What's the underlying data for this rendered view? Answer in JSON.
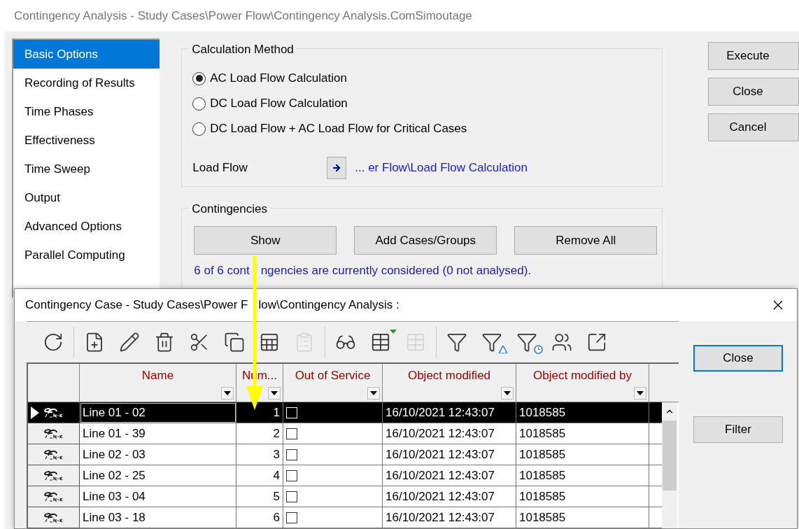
{
  "window": {
    "title": "Contingency Analysis - Study Cases\\Power Flow\\Contingency Analysis.ComSimoutage"
  },
  "sidebar": {
    "items": [
      {
        "label": "Basic Options",
        "selected": true
      },
      {
        "label": "Recording of Results",
        "selected": false
      },
      {
        "label": "Time Phases",
        "selected": false
      },
      {
        "label": "Effectiveness",
        "selected": false
      },
      {
        "label": "Time Sweep",
        "selected": false
      },
      {
        "label": "Output",
        "selected": false
      },
      {
        "label": "Advanced Options",
        "selected": false
      },
      {
        "label": "Parallel Computing",
        "selected": false
      }
    ]
  },
  "calculation_method": {
    "label": "Calculation Method",
    "options": [
      {
        "label": "AC Load Flow Calculation",
        "selected": true
      },
      {
        "label": "DC Load Flow Calculation",
        "selected": false
      },
      {
        "label": "DC Load Flow + AC Load Flow for Critical Cases",
        "selected": false
      }
    ],
    "load_flow": {
      "label": "Load Flow",
      "link": "... er Flow\\Load Flow Calculation"
    }
  },
  "contingencies": {
    "label": "Contingencies",
    "buttons": [
      "Show",
      "Add Cases/Groups",
      "Remove All"
    ],
    "status": [
      "6 of 6 cont",
      "ngencies are currently considered (0 not analysed)."
    ]
  },
  "buttons": [
    "Execute",
    "Close",
    "Cancel"
  ],
  "dialog": {
    "title": [
      "Contingency Case - Study Cases\\Power F",
      "low\\Contingency Analysis :"
    ],
    "toolbar": [
      [
        {
          "kind": "refresh",
          "disabled": false
        }
      ],
      [
        {
          "kind": "new",
          "disabled": false
        },
        {
          "kind": "edit",
          "disabled": false
        },
        {
          "kind": "delete",
          "disabled": false
        },
        {
          "kind": "cut",
          "disabled": false
        },
        {
          "kind": "copy",
          "disabled": false
        },
        {
          "kind": "copy-table",
          "disabled": false
        },
        {
          "kind": "paste",
          "disabled": true
        }
      ],
      [
        {
          "kind": "view",
          "disabled": false
        },
        {
          "kind": "table-select",
          "disabled": false
        },
        {
          "kind": "table",
          "disabled": true
        }
      ],
      [
        {
          "kind": "filter",
          "disabled": false
        },
        {
          "kind": "filter-warning",
          "disabled": false
        },
        {
          "kind": "filter-time",
          "disabled": false
        },
        {
          "kind": "users",
          "disabled": false
        },
        {
          "kind": "export",
          "disabled": false
        }
      ]
    ],
    "columns": [
      "Name",
      "Num...",
      "Out of Service",
      "Object modified",
      "Object modified by"
    ],
    "rows": [
      {
        "selected": true,
        "name": "Line 01 - 02",
        "number": "1",
        "out_of_service": false,
        "modified": "16/10/2021 12:43:07",
        "modified_by": "1018585"
      },
      {
        "selected": false,
        "name": "Line 01 - 39",
        "number": "2",
        "out_of_service": false,
        "modified": "16/10/2021 12:43:07",
        "modified_by": "1018585"
      },
      {
        "selected": false,
        "name": "Line 02 - 03",
        "number": "3",
        "out_of_service": false,
        "modified": "16/10/2021 12:43:07",
        "modified_by": "1018585"
      },
      {
        "selected": false,
        "name": "Line 02 - 25",
        "number": "4",
        "out_of_service": false,
        "modified": "16/10/2021 12:43:07",
        "modified_by": "1018585"
      },
      {
        "selected": false,
        "name": "Line 03 - 04",
        "number": "5",
        "out_of_service": false,
        "modified": "16/10/2021 12:43:07",
        "modified_by": "1018585"
      },
      {
        "selected": false,
        "name": "Line 03 - 18",
        "number": "6",
        "out_of_service": false,
        "modified": "16/10/2021 12:43:07",
        "modified_by": "1018585"
      }
    ],
    "buttons": [
      "Close",
      "Filter"
    ]
  }
}
